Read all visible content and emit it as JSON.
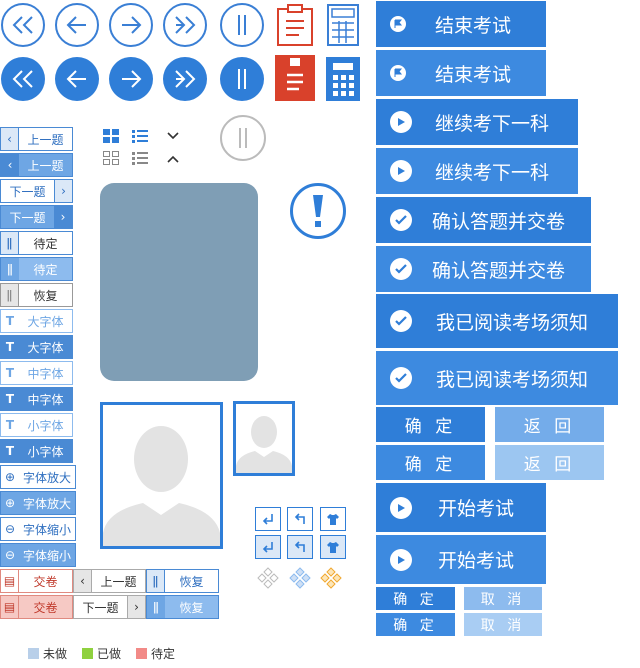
{
  "colors": {
    "primary": "#2f7ed8",
    "primary_light": "#3d8ae0",
    "pale": "#9cc6f1",
    "red": "#d9412b"
  },
  "nav_icons": [
    "first-icon",
    "prev-icon",
    "next-icon",
    "last-icon",
    "pause-icon",
    "paper-icon",
    "calculator-icon"
  ],
  "side": {
    "prev_q": "上一题",
    "next_q": "下一题",
    "pending": "待定",
    "resume": "恢复",
    "large_font": "大字体",
    "medium_font": "中字体",
    "small_font": "小字体",
    "zoom_in": "字体放大",
    "zoom_out": "字体缩小",
    "submit": "交卷"
  },
  "right": {
    "end_exam": "结束考试",
    "next_subject": "继续考下一科",
    "confirm_submit": "确认答题并交卷",
    "read_rules": "我已阅读考场须知",
    "ok": "确 定",
    "back": "返 回",
    "start_exam": "开始考试",
    "cancel": "取 消"
  },
  "legend": {
    "not_done": "未做",
    "done": "已做",
    "pending": "待定"
  },
  "legend_colors": {
    "not_done": "#b8cfe9",
    "done": "#8fd13f",
    "pending": "#f28a87"
  }
}
